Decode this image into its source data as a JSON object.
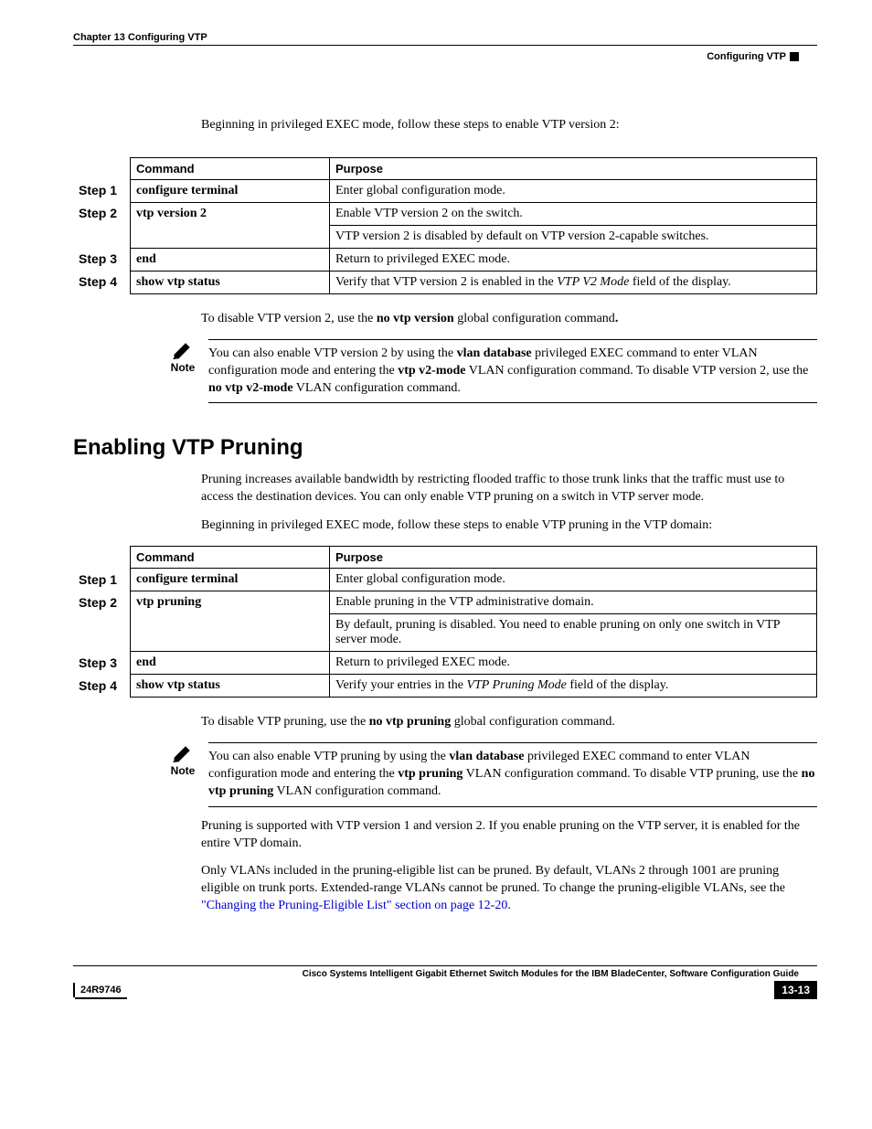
{
  "header": {
    "chapter": "Chapter 13    Configuring VTP",
    "section": "Configuring VTP"
  },
  "section1": {
    "intro": "Beginning in privileged EXEC mode, follow these steps to enable VTP version 2:",
    "table": {
      "headCommand": "Command",
      "headPurpose": "Purpose",
      "rows": [
        {
          "step": "Step 1",
          "cmd": "configure terminal",
          "purpose1": "Enter global configuration mode."
        },
        {
          "step": "Step 2",
          "cmd": "vtp version 2",
          "purpose1": "Enable VTP version 2 on the switch.",
          "purpose2": "VTP version 2 is disabled by default on VTP version 2-capable switches."
        },
        {
          "step": "Step 3",
          "cmd": "end",
          "purpose1": "Return to privileged EXEC mode."
        },
        {
          "step": "Step 4",
          "cmd": "show vtp status",
          "purpose_pre": "Verify that VTP version 2 is enabled in the ",
          "purpose_italic": "VTP V2 Mode",
          "purpose_post": " field of the display."
        }
      ]
    },
    "disable_pre": "To disable VTP version 2, use the ",
    "disable_bold": "no vtp version",
    "disable_post": " global configuration command",
    "disable_dot": ".",
    "note_label": "Note",
    "note_p1_a": "You can also enable VTP version 2 by using the ",
    "note_p1_b": "vlan database",
    "note_p1_c": " privileged EXEC command to enter VLAN configuration mode and entering the ",
    "note_p1_d": "vtp v2-mode",
    "note_p1_e": " VLAN configuration command. To disable VTP version 2, use the ",
    "note_p1_f": "no vtp v2-mode",
    "note_p1_g": " VLAN configuration command."
  },
  "section2": {
    "heading": "Enabling VTP Pruning",
    "p1": "Pruning increases available bandwidth by restricting flooded traffic to those trunk links that the traffic must use to access the destination devices. You can only enable VTP pruning on a switch in VTP server mode.",
    "p2": "Beginning in privileged EXEC mode, follow these steps to enable VTP pruning in the VTP domain:",
    "table": {
      "headCommand": "Command",
      "headPurpose": "Purpose",
      "rows": [
        {
          "step": "Step 1",
          "cmd": "configure terminal",
          "purpose1": "Enter global configuration mode."
        },
        {
          "step": "Step 2",
          "cmd": "vtp pruning",
          "purpose1": "Enable pruning in the VTP administrative domain.",
          "purpose2": "By default, pruning is disabled. You need to enable pruning on only one switch in VTP server mode."
        },
        {
          "step": "Step 3",
          "cmd": "end",
          "purpose1": "Return to privileged EXEC mode."
        },
        {
          "step": "Step 4",
          "cmd": "show vtp status",
          "purpose_pre": "Verify your entries in the ",
          "purpose_italic": "VTP Pruning Mode",
          "purpose_post": " field of the display."
        }
      ]
    },
    "disable_pre": "To disable VTP pruning, use the ",
    "disable_bold": "no vtp pruning",
    "disable_post": " global configuration command.",
    "note_label": "Note",
    "note_p1_a": "You can also enable VTP pruning by using the ",
    "note_p1_b": "vlan database",
    "note_p1_c": " privileged EXEC command to enter VLAN configuration mode and entering the ",
    "note_p1_d": "vtp pruning",
    "note_p1_e": " VLAN configuration command. To disable VTP pruning, use the ",
    "note_p1_f": "no vtp pruning",
    "note_p1_g": " VLAN configuration command.",
    "p3": "Pruning is supported with VTP version 1 and version 2. If you enable pruning on the VTP server, it is enabled for the entire VTP domain.",
    "p4_a": "Only VLANs included in the pruning-eligible list can be pruned. By default, VLANs 2 through 1001 are pruning eligible on trunk ports. Extended-range VLANs cannot be pruned. To change the pruning-eligible VLANs, see the ",
    "p4_link": "\"Changing the Pruning-Eligible List\" section on page 12-20",
    "p4_b": "."
  },
  "footer": {
    "title": "Cisco Systems Intelligent Gigabit Ethernet Switch Modules for the IBM BladeCenter, Software Configuration Guide",
    "docnum": "24R9746",
    "pagenum": "13-13"
  }
}
